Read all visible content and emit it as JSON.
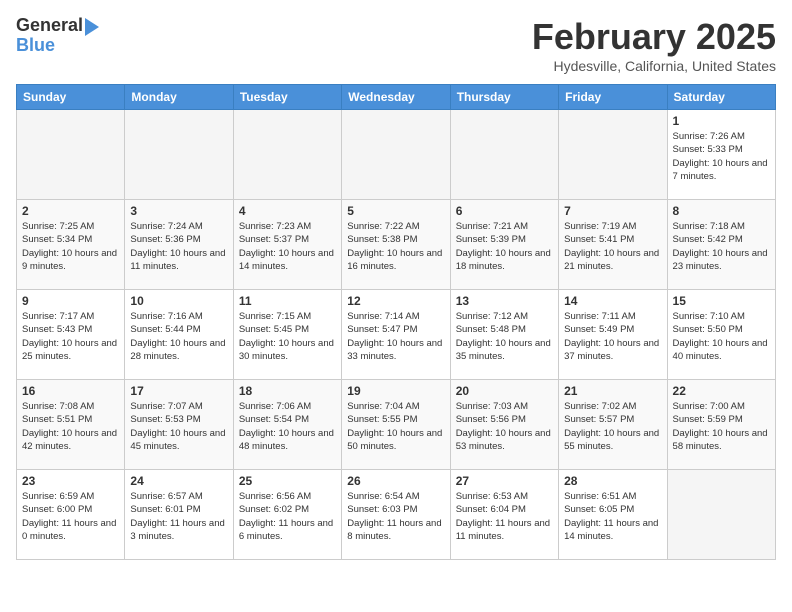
{
  "header": {
    "logo_line1": "General",
    "logo_line2": "Blue",
    "month_year": "February 2025",
    "location": "Hydesville, California, United States"
  },
  "weekdays": [
    "Sunday",
    "Monday",
    "Tuesday",
    "Wednesday",
    "Thursday",
    "Friday",
    "Saturday"
  ],
  "weeks": [
    [
      {
        "day": "",
        "info": ""
      },
      {
        "day": "",
        "info": ""
      },
      {
        "day": "",
        "info": ""
      },
      {
        "day": "",
        "info": ""
      },
      {
        "day": "",
        "info": ""
      },
      {
        "day": "",
        "info": ""
      },
      {
        "day": "1",
        "info": "Sunrise: 7:26 AM\nSunset: 5:33 PM\nDaylight: 10 hours and 7 minutes."
      }
    ],
    [
      {
        "day": "2",
        "info": "Sunrise: 7:25 AM\nSunset: 5:34 PM\nDaylight: 10 hours and 9 minutes."
      },
      {
        "day": "3",
        "info": "Sunrise: 7:24 AM\nSunset: 5:36 PM\nDaylight: 10 hours and 11 minutes."
      },
      {
        "day": "4",
        "info": "Sunrise: 7:23 AM\nSunset: 5:37 PM\nDaylight: 10 hours and 14 minutes."
      },
      {
        "day": "5",
        "info": "Sunrise: 7:22 AM\nSunset: 5:38 PM\nDaylight: 10 hours and 16 minutes."
      },
      {
        "day": "6",
        "info": "Sunrise: 7:21 AM\nSunset: 5:39 PM\nDaylight: 10 hours and 18 minutes."
      },
      {
        "day": "7",
        "info": "Sunrise: 7:19 AM\nSunset: 5:41 PM\nDaylight: 10 hours and 21 minutes."
      },
      {
        "day": "8",
        "info": "Sunrise: 7:18 AM\nSunset: 5:42 PM\nDaylight: 10 hours and 23 minutes."
      }
    ],
    [
      {
        "day": "9",
        "info": "Sunrise: 7:17 AM\nSunset: 5:43 PM\nDaylight: 10 hours and 25 minutes."
      },
      {
        "day": "10",
        "info": "Sunrise: 7:16 AM\nSunset: 5:44 PM\nDaylight: 10 hours and 28 minutes."
      },
      {
        "day": "11",
        "info": "Sunrise: 7:15 AM\nSunset: 5:45 PM\nDaylight: 10 hours and 30 minutes."
      },
      {
        "day": "12",
        "info": "Sunrise: 7:14 AM\nSunset: 5:47 PM\nDaylight: 10 hours and 33 minutes."
      },
      {
        "day": "13",
        "info": "Sunrise: 7:12 AM\nSunset: 5:48 PM\nDaylight: 10 hours and 35 minutes."
      },
      {
        "day": "14",
        "info": "Sunrise: 7:11 AM\nSunset: 5:49 PM\nDaylight: 10 hours and 37 minutes."
      },
      {
        "day": "15",
        "info": "Sunrise: 7:10 AM\nSunset: 5:50 PM\nDaylight: 10 hours and 40 minutes."
      }
    ],
    [
      {
        "day": "16",
        "info": "Sunrise: 7:08 AM\nSunset: 5:51 PM\nDaylight: 10 hours and 42 minutes."
      },
      {
        "day": "17",
        "info": "Sunrise: 7:07 AM\nSunset: 5:53 PM\nDaylight: 10 hours and 45 minutes."
      },
      {
        "day": "18",
        "info": "Sunrise: 7:06 AM\nSunset: 5:54 PM\nDaylight: 10 hours and 48 minutes."
      },
      {
        "day": "19",
        "info": "Sunrise: 7:04 AM\nSunset: 5:55 PM\nDaylight: 10 hours and 50 minutes."
      },
      {
        "day": "20",
        "info": "Sunrise: 7:03 AM\nSunset: 5:56 PM\nDaylight: 10 hours and 53 minutes."
      },
      {
        "day": "21",
        "info": "Sunrise: 7:02 AM\nSunset: 5:57 PM\nDaylight: 10 hours and 55 minutes."
      },
      {
        "day": "22",
        "info": "Sunrise: 7:00 AM\nSunset: 5:59 PM\nDaylight: 10 hours and 58 minutes."
      }
    ],
    [
      {
        "day": "23",
        "info": "Sunrise: 6:59 AM\nSunset: 6:00 PM\nDaylight: 11 hours and 0 minutes."
      },
      {
        "day": "24",
        "info": "Sunrise: 6:57 AM\nSunset: 6:01 PM\nDaylight: 11 hours and 3 minutes."
      },
      {
        "day": "25",
        "info": "Sunrise: 6:56 AM\nSunset: 6:02 PM\nDaylight: 11 hours and 6 minutes."
      },
      {
        "day": "26",
        "info": "Sunrise: 6:54 AM\nSunset: 6:03 PM\nDaylight: 11 hours and 8 minutes."
      },
      {
        "day": "27",
        "info": "Sunrise: 6:53 AM\nSunset: 6:04 PM\nDaylight: 11 hours and 11 minutes."
      },
      {
        "day": "28",
        "info": "Sunrise: 6:51 AM\nSunset: 6:05 PM\nDaylight: 11 hours and 14 minutes."
      },
      {
        "day": "",
        "info": ""
      }
    ]
  ]
}
